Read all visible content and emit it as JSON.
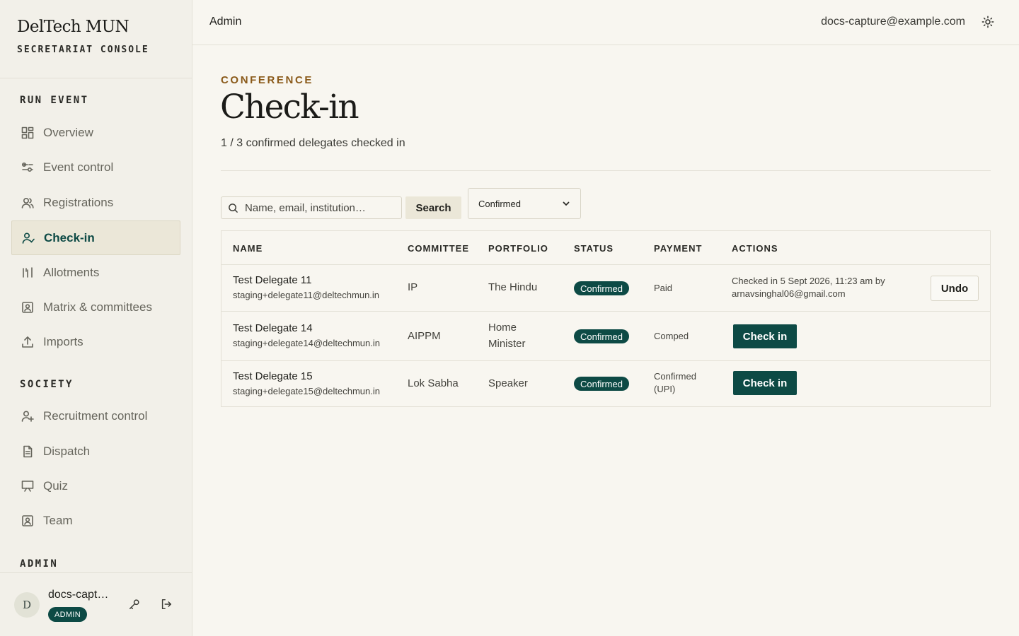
{
  "brand": {
    "name": "DelTech MUN",
    "subtitle": "SECRETARIAT CONSOLE"
  },
  "sidebar": {
    "sections": [
      {
        "label": "RUN EVENT"
      },
      {
        "label": "SOCIETY"
      },
      {
        "label": "ADMIN"
      }
    ],
    "items": [
      {
        "label": "Overview",
        "icon": "dashboard-icon"
      },
      {
        "label": "Event control",
        "icon": "sliders-icon"
      },
      {
        "label": "Registrations",
        "icon": "users-icon"
      },
      {
        "label": "Check-in",
        "icon": "user-check-icon",
        "active": true
      },
      {
        "label": "Allotments",
        "icon": "columns-icon"
      },
      {
        "label": "Matrix & committees",
        "icon": "id-badge-icon"
      },
      {
        "label": "Imports",
        "icon": "upload-icon"
      },
      {
        "label": "Recruitment control",
        "icon": "user-plus-icon"
      },
      {
        "label": "Dispatch",
        "icon": "document-icon"
      },
      {
        "label": "Quiz",
        "icon": "presentation-icon"
      },
      {
        "label": "Team",
        "icon": "id-badge-icon"
      }
    ]
  },
  "user": {
    "initial": "D",
    "name": "docs-capt…",
    "role": "ADMIN"
  },
  "topbar": {
    "breadcrumb": "Admin",
    "email": "docs-capture@example.com"
  },
  "page": {
    "eyebrow": "CONFERENCE",
    "title": "Check-in",
    "subtitle": "1 / 3 confirmed delegates checked in"
  },
  "filters": {
    "search_placeholder": "Name, email, institution…",
    "search_button": "Search",
    "status_value": "Confirmed"
  },
  "table": {
    "headers": [
      "NAME",
      "COMMITTEE",
      "PORTFOLIO",
      "STATUS",
      "PAYMENT",
      "ACTIONS"
    ],
    "rows": [
      {
        "name": "Test Delegate 11",
        "email": "staging+delegate11@deltechmun.in",
        "committee": "IP",
        "portfolio": "The Hindu",
        "status": "Confirmed",
        "payment": "Paid",
        "checked_in_note": "Checked in 5 Sept 2026, 11:23 am by arnavsinghal06@gmail.com",
        "action": "Undo"
      },
      {
        "name": "Test Delegate 14",
        "email": "staging+delegate14@deltechmun.in",
        "committee": "AIPPM",
        "portfolio": "Home Minister",
        "status": "Confirmed",
        "payment": "Comped",
        "action": "Check in"
      },
      {
        "name": "Test Delegate 15",
        "email": "staging+delegate15@deltechmun.in",
        "committee": "Lok Sabha",
        "portfolio": "Speaker",
        "status": "Confirmed",
        "payment": "Confirmed (UPI)",
        "action": "Check in"
      }
    ]
  },
  "colors": {
    "accent": "#0d4a45",
    "eyebrow": "#8a5a1a",
    "background": "#f8f6f0",
    "sidebar": "#f2f0e9"
  }
}
